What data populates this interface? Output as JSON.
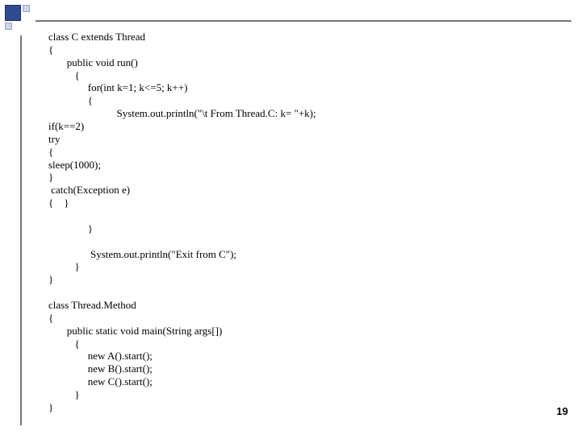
{
  "slide": {
    "page_number": "19",
    "code": {
      "l01": "class C extends Thread",
      "l02": "{",
      "l03": "       public void run()",
      "l04": "          {",
      "l05": "               for(int k=1; k<=5; k++)",
      "l06": "               {",
      "l07": "                          System.out.println(\"\\t From Thread.C: k= \"+k);",
      "l08": "if(k==2)",
      "l09": "try",
      "l10": "{",
      "l11": "sleep(1000);",
      "l12": "}",
      "l13": " catch(Exception e)",
      "l14": "{    }",
      "l15": "",
      "l16": "               }",
      "l17": "",
      "l18": "                System.out.println(\"Exit from C\");",
      "l19": "          }",
      "l20": "}",
      "l21": "",
      "l22": "class Thread.Method",
      "l23": "{",
      "l24": "       public static void main(String args[])",
      "l25": "          {",
      "l26": "               new A().start();",
      "l27": "               new B().start();",
      "l28": "               new C().start();",
      "l29": "          }",
      "l30": "}"
    }
  }
}
